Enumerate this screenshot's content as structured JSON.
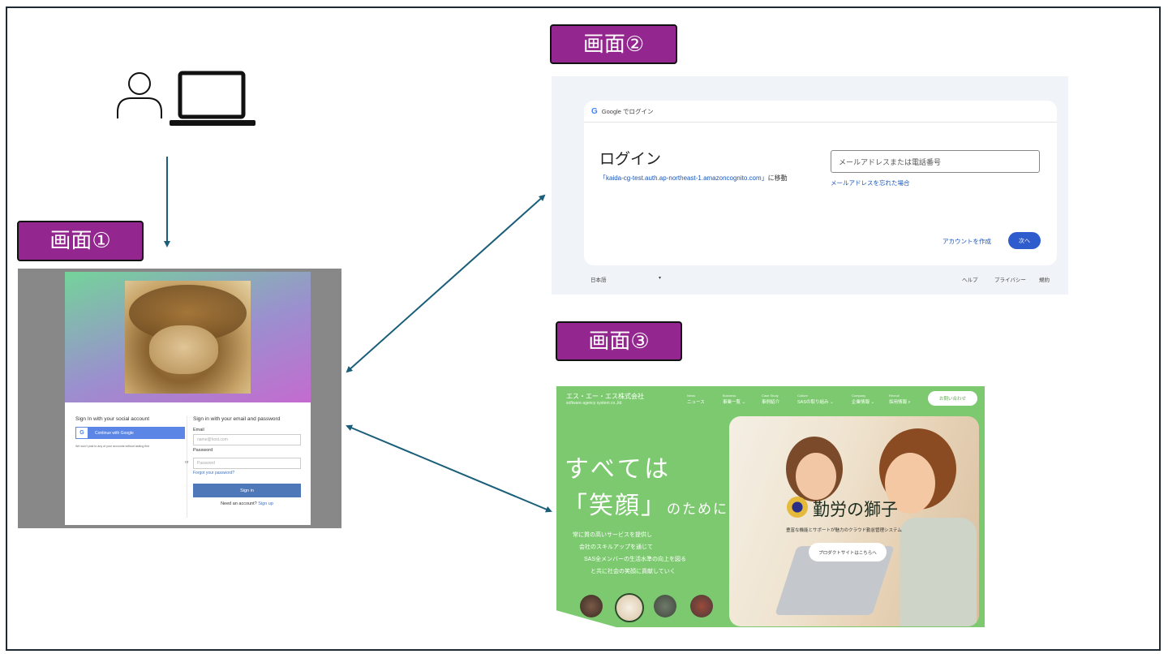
{
  "labels": {
    "screen1": "画面①",
    "screen2": "画面②",
    "screen3": "画面③"
  },
  "icons": {
    "user": "person-outline",
    "computer": "laptop"
  },
  "screen1": {
    "social_heading": "Sign In with your social account",
    "google_button": "Continue with Google",
    "google_glyph": "G",
    "disclaimer": "We won't post to any of your accounts without asking first",
    "or": "or",
    "email_heading": "Sign in with your email and password",
    "email_label": "Email",
    "email_placeholder": "name@host.com",
    "password_label": "Password",
    "password_placeholder": "Password",
    "forgot": "Forgot your password?",
    "sign_in": "Sign in",
    "need_account": "Need an account?",
    "sign_up": "Sign up"
  },
  "screen2": {
    "header": "Google でログイン",
    "google_glyph": "G",
    "title": "ログイン",
    "redirect_url": "「kaida-cg-test.auth.ap-northeast-1.amazoncognito.com」",
    "redirect_suffix": "に移動",
    "field_placeholder": "メールアドレスまたは電話番号",
    "forgot": "メールアドレスを忘れた場合",
    "create": "アカウントを作成",
    "next": "次へ",
    "language": "日本語",
    "caret": "▾",
    "help": "ヘルプ",
    "privacy": "プライバシー",
    "terms": "規約"
  },
  "screen3": {
    "logo_main": "エス・エー・エス株式会社",
    "logo_sub": "software agency system co.,ltd",
    "nav": [
      {
        "en": "News",
        "ja": "ニュース"
      },
      {
        "en": "Business",
        "ja": "事業一覧 ⌄"
      },
      {
        "en": "Case Study",
        "ja": "事例紹介"
      },
      {
        "en": "Culture",
        "ja": "SASの取り組み ⌄"
      },
      {
        "en": "Company",
        "ja": "企業情報 ⌄"
      },
      {
        "en": "Recruit",
        "ja": "採用情報 ⌕"
      }
    ],
    "contact": "お問い合わせ",
    "tagline1": "すべては",
    "tagline2_main": "「笑顔」",
    "tagline2_tail": "のために",
    "body": [
      "常に質の高いサービスを提供し",
      "会社のスキルアップを通じて",
      "SAS全メンバーの生活水準の向上を図る",
      "と共に社会の笑顔に貢献していく"
    ],
    "brand": "勤労の獅子",
    "brand_sub": "豊富な機能とサポートが魅力のクラウド勤怠管理システム",
    "product_button": "プロダクトサイトはこちらへ"
  },
  "colors": {
    "label_bg": "#93268f",
    "arrow": "#1b5e7a",
    "screen3_green": "#7cc96f",
    "google_blue": "#2f5ccc"
  }
}
